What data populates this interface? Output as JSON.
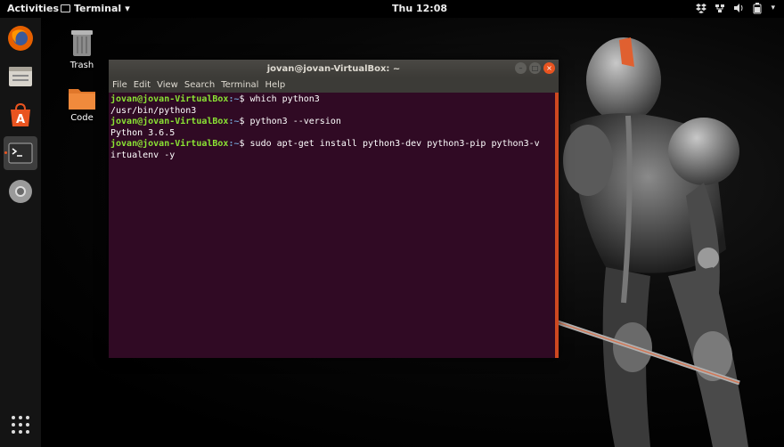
{
  "top_bar": {
    "activities": "Activities",
    "app_name": "Terminal",
    "clock": "Thu 12:08",
    "tray_icons": [
      "dropbox-icon",
      "network-icon",
      "volume-icon",
      "battery-icon",
      "power-menu-icon"
    ]
  },
  "dock": {
    "items": [
      {
        "name": "firefox-icon"
      },
      {
        "name": "files-icon"
      },
      {
        "name": "software-center-icon"
      },
      {
        "name": "terminal-icon",
        "active": true
      },
      {
        "name": "chrome-icon"
      }
    ],
    "show_apps_icon": "app-grid-icon"
  },
  "desktop": {
    "icons": [
      {
        "label": "Trash",
        "icon": "trash-icon"
      },
      {
        "label": "Code",
        "icon": "folder-icon"
      }
    ]
  },
  "terminal": {
    "title": "jovan@jovan-VirtualBox: ~",
    "menu": [
      "File",
      "Edit",
      "View",
      "Search",
      "Terminal",
      "Help"
    ],
    "lines": [
      {
        "prompt": "jovan@jovan-VirtualBox",
        "path": ":~",
        "cmd": "$ which python3"
      },
      {
        "output": "/usr/bin/python3"
      },
      {
        "prompt": "jovan@jovan-VirtualBox",
        "path": ":~",
        "cmd": "$ python3 --version"
      },
      {
        "output": "Python 3.6.5"
      },
      {
        "prompt": "jovan@jovan-VirtualBox",
        "path": ":~",
        "cmd": "$ sudo apt-get install python3-dev python3-pip python3-v"
      },
      {
        "output": "irtualenv -y"
      }
    ],
    "colors": {
      "background": "#300a24",
      "prompt": "#8ae234",
      "path": "#729fcf",
      "accent": "#e95420"
    }
  }
}
